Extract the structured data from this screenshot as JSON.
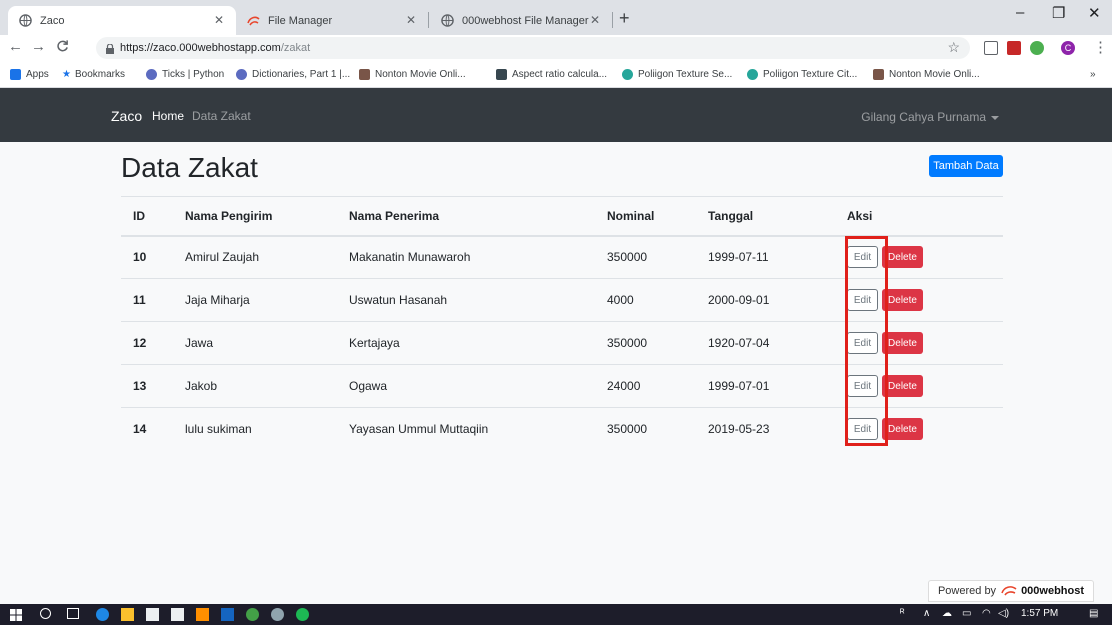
{
  "browser": {
    "tabs": [
      {
        "title": "Zaco",
        "active": true
      },
      {
        "title": "File Manager",
        "active": false
      },
      {
        "title": "000webhost File Manager",
        "active": false
      }
    ],
    "url_host": "https://zaco.000webhostapp.com",
    "url_path": "/zakat",
    "bookmarks": [
      "Apps",
      "Bookmarks",
      "Ticks | Python",
      "Dictionaries, Part 1 |...",
      "Nonton Movie Onli...",
      "Aspect ratio calcula...",
      "Poliigon Texture Se...",
      "Poliigon Texture Cit...",
      "Nonton Movie Onli..."
    ],
    "profile_initial": "C",
    "overflow": "»"
  },
  "navbar": {
    "brand": "Zaco",
    "links": [
      "Home",
      "Data Zakat"
    ],
    "user": "Gilang Cahya Purnama"
  },
  "page": {
    "title": "Data Zakat",
    "add_button": "Tambah Data",
    "columns": [
      "ID",
      "Nama Pengirim",
      "Nama Penerima",
      "Nominal",
      "Tanggal",
      "Aksi"
    ],
    "rows": [
      {
        "id": "10",
        "pengirim": "Amirul Zaujah",
        "penerima": "Makanatin Munawaroh",
        "nominal": "350000",
        "tanggal": "1999-07-11"
      },
      {
        "id": "11",
        "pengirim": "Jaja Miharja",
        "penerima": "Uswatun Hasanah",
        "nominal": "4000",
        "tanggal": "2000-09-01"
      },
      {
        "id": "12",
        "pengirim": "Jawa",
        "penerima": "Kertajaya",
        "nominal": "350000",
        "tanggal": "1920-07-04"
      },
      {
        "id": "13",
        "pengirim": "Jakob",
        "penerima": "Ogawa",
        "nominal": "24000",
        "tanggal": "1999-07-01"
      },
      {
        "id": "14",
        "pengirim": "lulu sukiman",
        "penerima": "Yayasan Ummul Muttaqiin",
        "nominal": "350000",
        "tanggal": "2019-05-23"
      }
    ],
    "edit_label": "Edit",
    "delete_label": "Delete",
    "powered_by": "Powered by",
    "powered_brand": "000webhost"
  },
  "taskbar": {
    "time": "1:57 PM"
  },
  "colors": {
    "primary": "#007bff",
    "danger": "#dc3545",
    "navbar": "#343a40",
    "highlight": "#e0201a"
  }
}
